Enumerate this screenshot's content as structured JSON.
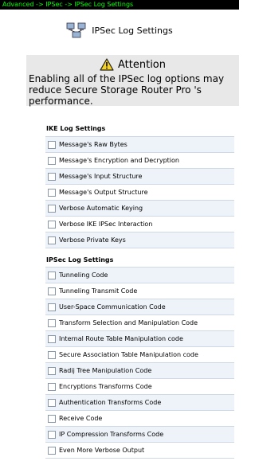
{
  "breadcrumb": "Advanced -> IPSec -> IPSec Log Settings",
  "header": {
    "title": "IPSec Log Settings",
    "icon": "network-computers-icon"
  },
  "attention": {
    "title": "Attention",
    "icon": "warning-triangle-icon",
    "message": "Enabling all of the IPSec log options may reduce Secure Storage Router Pro 's performance."
  },
  "ike": {
    "title": "IKE Log Settings",
    "items": [
      "Message's Raw Bytes",
      "Message's Encryption and Decryption",
      "Message's Input Structure",
      "Message's Output Structure",
      "Verbose Automatic Keying",
      "Verbose IKE IPSec Interaction",
      "Verbose Private Keys"
    ]
  },
  "ipsec": {
    "title": "IPSec Log Settings",
    "items": [
      "Tunneling Code",
      "Tunneling Transmit Code",
      "User-Space Communication Code",
      "Transform Selection and Manipulation Code",
      "Internal Route Table Manipulation code",
      "Secure Association Table Manipulation code",
      "Radij Tree Manipulation Code",
      "Encryptions Transforms Code",
      "Authentication Transforms Code",
      "Receive Code",
      "IP Compression Transforms Code",
      "Even More Verbose Output"
    ]
  },
  "colors": {
    "breadcrumb_bg": "#000000",
    "breadcrumb_text": "#00ff00",
    "attention_bg": "#e8e8e8",
    "row_alt": "#eef3f9"
  }
}
